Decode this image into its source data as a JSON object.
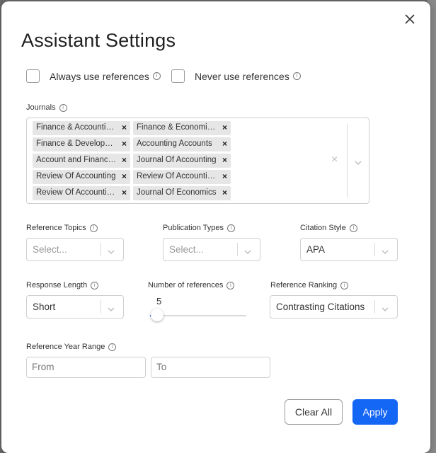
{
  "dialog": {
    "title": "Assistant Settings",
    "close_icon": "close-icon"
  },
  "checkboxes": {
    "always_label": "Always use references",
    "always_checked": false,
    "never_label": "Never use references",
    "never_checked": false,
    "info_icon": "info-icon"
  },
  "journals": {
    "label": "Journals",
    "tags": [
      "Finance & Accounting Research",
      "Finance & Economics Review",
      "Finance & Development",
      "Accounting Accounts",
      "Account and Financial Management",
      "Journal Of Accounting",
      "Review Of Accounting",
      "Review Of Accounting Studies",
      "Review Of Accounting Review",
      "Journal Of Economics"
    ]
  },
  "fields": {
    "reference_topics": {
      "label": "Reference Topics",
      "placeholder": "Select..."
    },
    "publication_types": {
      "label": "Publication Types",
      "placeholder": "Select..."
    },
    "citation_style": {
      "label": "Citation Style",
      "value": "APA"
    },
    "response_length": {
      "label": "Response Length",
      "value": "Short"
    },
    "number_of_references": {
      "label": "Number of references",
      "value": "5",
      "fraction": 0.0
    },
    "reference_ranking": {
      "label": "Reference Ranking",
      "value": "Contrasting Citations"
    },
    "year_range": {
      "label": "Reference Year Range",
      "from_placeholder": "From",
      "to_placeholder": "To"
    }
  },
  "buttons": {
    "clear_all": "Clear All",
    "apply": "Apply"
  },
  "colors": {
    "accent": "#1466f5"
  }
}
